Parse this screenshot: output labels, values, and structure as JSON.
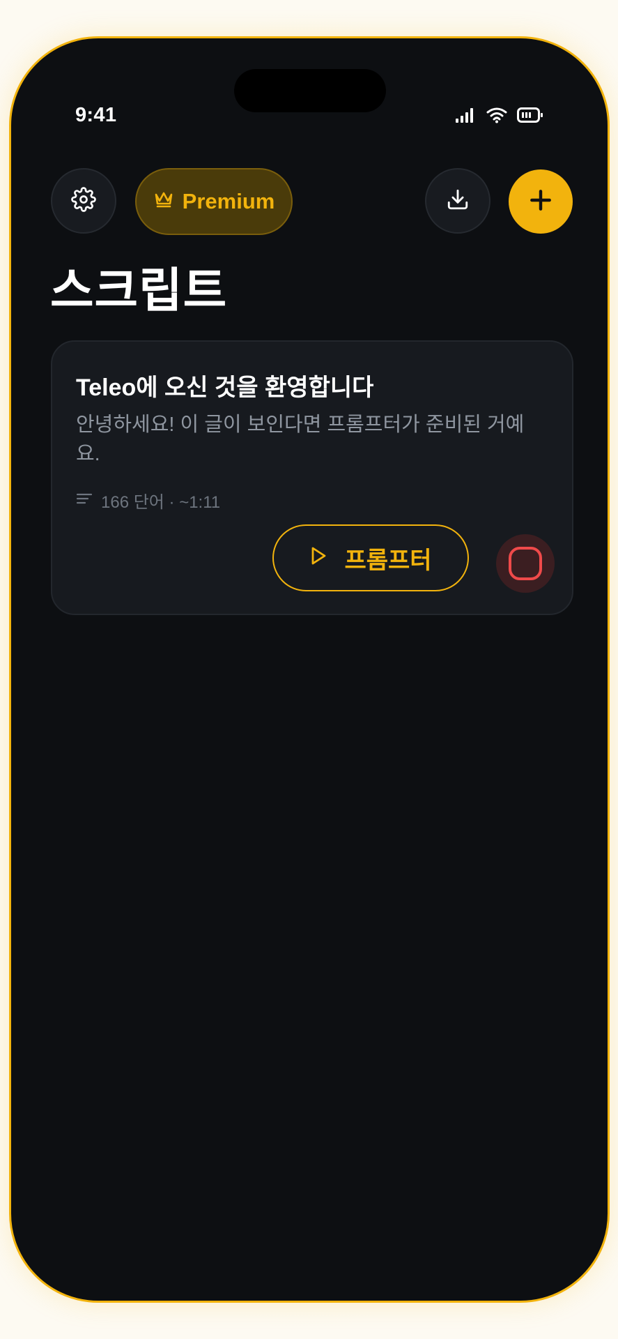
{
  "status_bar": {
    "time": "9:41",
    "icons": [
      "cellular-signal-icon",
      "wifi-icon",
      "battery-icon"
    ]
  },
  "toolbar": {
    "settings_icon": "gear-icon",
    "premium_label": "Premium",
    "premium_icon": "crown-icon",
    "import_icon": "download-icon",
    "add_icon": "plus-icon"
  },
  "page": {
    "title": "스크립트"
  },
  "scripts": [
    {
      "title": "Teleo에 오신 것을 환영합니다",
      "preview": "안녕하세요! 이 글이 보인다면 프롬프터가 준비된 거예요.",
      "meta": "166 단어 · ~1:11",
      "meta_icon": "text-lines-icon",
      "prompter_label": "프롬프터",
      "prompter_icon": "play-icon",
      "record_icon": "record-icon"
    }
  ],
  "colors": {
    "accent": "#f2b30d",
    "background": "#0d0f12",
    "card": "#171a1f",
    "record": "#ef4a4a"
  }
}
